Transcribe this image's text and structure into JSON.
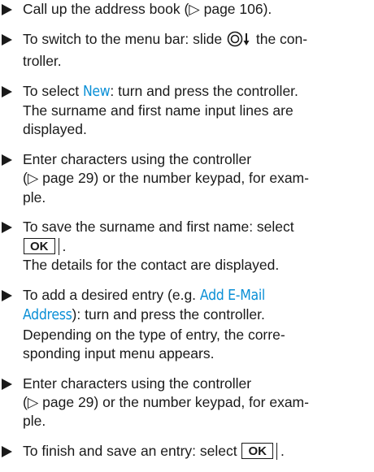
{
  "steps": [
    {
      "lines": [
        "Call up the address book (▷ page 106)."
      ]
    },
    {
      "line1_pre": "To switch to the menu bar: slide ",
      "line1_post": " the con-",
      "line2": "troller.",
      "icon": "controller-slide-down-icon"
    },
    {
      "line1_pre": "To select ",
      "highlight": "New",
      "line1_post": ": turn and press the controller.",
      "lines": [
        "The surname and first name input lines are",
        "displayed."
      ]
    },
    {
      "lines": [
        "Enter characters using the controller",
        "(▷ page 29) or the number keypad, for exam-",
        "ple."
      ]
    },
    {
      "line1": "To save the surname and first name: select",
      "button": "OK",
      "result": "The details for the contact are displayed."
    },
    {
      "line1_pre": "To add a desired entry (e.g. ",
      "highlight_1": "Add E-Mail",
      "highlight_2": "Address",
      "line2_post": "): turn and press the controller.",
      "lines": [
        "Depending on the type of entry, the corre-",
        "sponding input menu appears."
      ]
    },
    {
      "lines": [
        "Enter characters using the controller",
        "(▷ page 29) or the number keypad, for exam-",
        "ple."
      ]
    },
    {
      "line1_pre": "To finish and save an entry: select ",
      "button": "OK",
      "line1_post": "."
    }
  ],
  "colors": {
    "highlight": "#0a8fd6",
    "text": "#1a1a1a"
  }
}
